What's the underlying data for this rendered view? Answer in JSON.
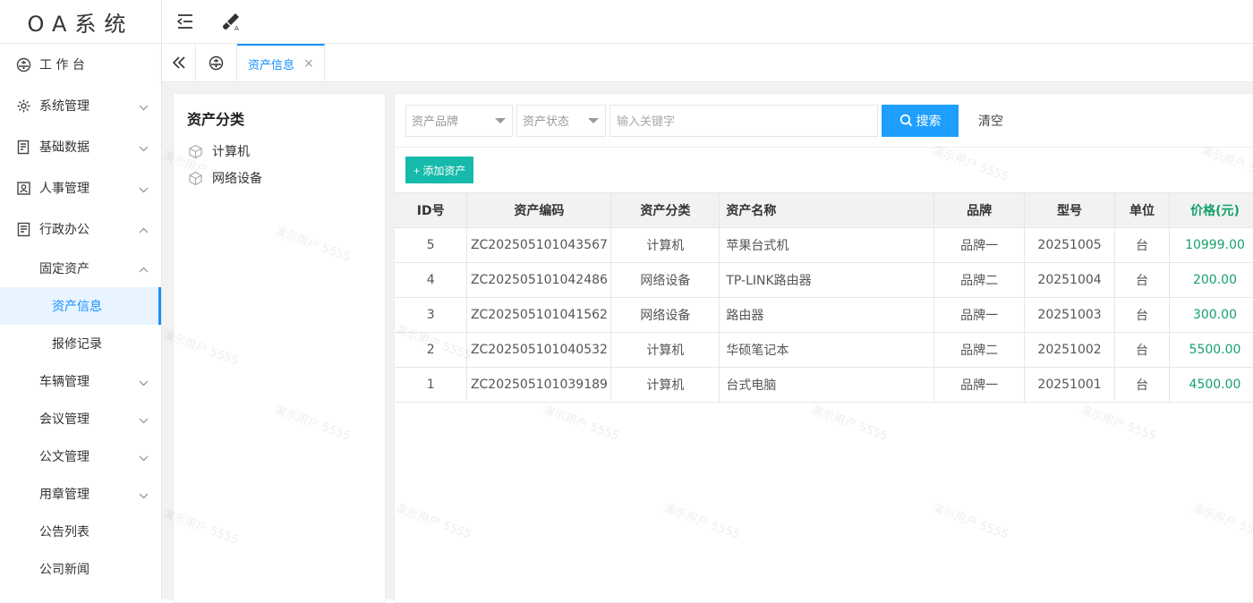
{
  "app": {
    "logo": "OA系统"
  },
  "sidebar": {
    "items": [
      {
        "label": "工 作 台",
        "icon": "dashboard-icon"
      },
      {
        "label": "系统管理",
        "icon": "gear-icon"
      },
      {
        "label": "基础数据",
        "icon": "document-icon"
      },
      {
        "label": "人事管理",
        "icon": "person-card-icon"
      },
      {
        "label": "行政办公",
        "icon": "office-icon"
      }
    ],
    "sub": {
      "fixed_assets": "固定资产",
      "asset_info": "资产信息",
      "repair_records": "报修记录",
      "vehicles": "车辆管理",
      "meetings": "会议管理",
      "documents": "公文管理",
      "seals": "用章管理",
      "notices": "公告列表",
      "news": "公司新闻"
    }
  },
  "tabs": {
    "active": "资产信息",
    "close": "×"
  },
  "category": {
    "title": "资产分类",
    "items": [
      "计算机",
      "网络设备"
    ]
  },
  "filters": {
    "brand_placeholder": "资产品牌",
    "status_placeholder": "资产状态",
    "keyword_placeholder": "输入关键字",
    "search_label": "搜索",
    "clear_label": "清空"
  },
  "toolbar": {
    "add_label": "+ 添加资产"
  },
  "table": {
    "headers": {
      "id": "ID号",
      "code": "资产编码",
      "category": "资产分类",
      "name": "资产名称",
      "brand": "品牌",
      "model": "型号",
      "unit": "单位",
      "price": "价格(元)"
    },
    "rows": [
      {
        "id": "5",
        "code": "ZC202505101043567",
        "category": "计算机",
        "name": "苹果台式机",
        "brand": "品牌一",
        "model": "20251005",
        "unit": "台",
        "price": "10999.00"
      },
      {
        "id": "4",
        "code": "ZC202505101042486",
        "category": "网络设备",
        "name": "TP-LINK路由器",
        "brand": "品牌二",
        "model": "20251004",
        "unit": "台",
        "price": "200.00"
      },
      {
        "id": "3",
        "code": "ZC202505101041562",
        "category": "网络设备",
        "name": "路由器",
        "brand": "品牌一",
        "model": "20251003",
        "unit": "台",
        "price": "300.00"
      },
      {
        "id": "2",
        "code": "ZC202505101040532",
        "category": "计算机",
        "name": "华硕笔记本",
        "brand": "品牌二",
        "model": "20251002",
        "unit": "台",
        "price": "5500.00"
      },
      {
        "id": "1",
        "code": "ZC202505101039189",
        "category": "计算机",
        "name": "台式电脑",
        "brand": "品牌一",
        "model": "20251001",
        "unit": "台",
        "price": "4500.00"
      }
    ]
  },
  "watermark": "演示用户 5555",
  "colors": {
    "accent": "#1890ff",
    "search": "#1e9fff",
    "add": "#16baaa",
    "price": "#16a06b"
  }
}
